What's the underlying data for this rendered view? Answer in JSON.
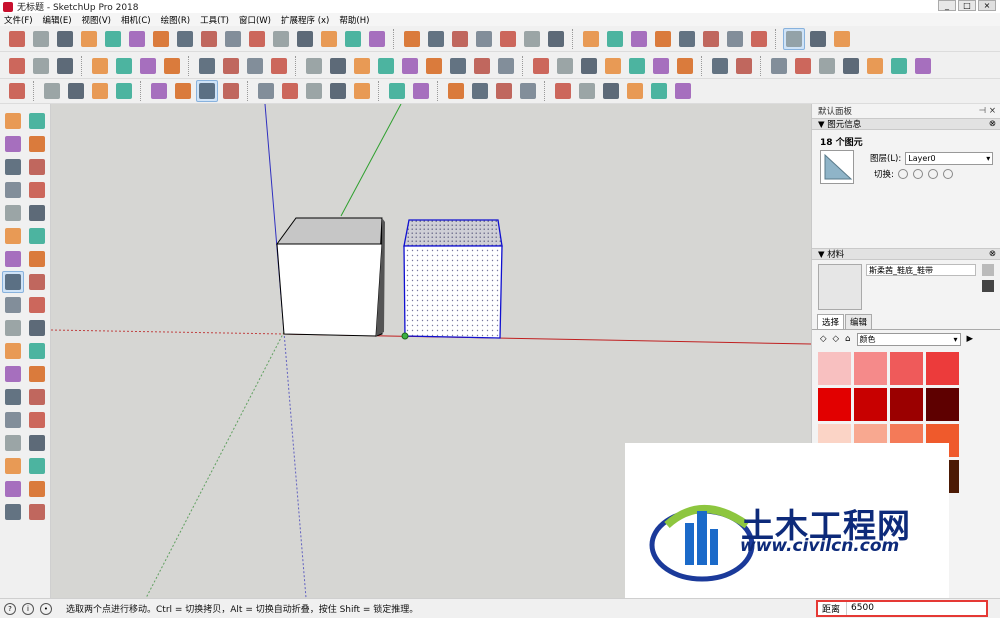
{
  "window": {
    "title": "无标题 - SketchUp Pro 2018",
    "controls": [
      "_",
      "□",
      "×"
    ]
  },
  "menu": [
    "文件(F)",
    "编辑(E)",
    "视图(V)",
    "相机(C)",
    "绘图(R)",
    "工具(T)",
    "窗口(W)",
    "扩展程序 (x)",
    "帮助(H)"
  ],
  "toolbar1_icons": [
    "select-icon",
    "make-component-icon",
    "paint-icon",
    "eraser-icon",
    "rectangle-icon",
    "line-icon",
    "circle-icon",
    "arc-icon",
    "polygon-icon",
    "freehand-icon",
    "move-icon",
    "pushpull-icon",
    "rotate-icon",
    "followme-icon",
    "scale-icon",
    "offset-icon",
    "tape-icon",
    "dimension-icon",
    "protractor-icon",
    "text-icon",
    "axes-icon",
    "3dtext-icon",
    "orbit-icon",
    "pan-icon",
    "zoom-icon",
    "zoom-extents-icon",
    "section-icon",
    "walk-icon",
    "lookaround-icon",
    "position-camera-icon",
    "sandbox-icon",
    "warehouse-icon",
    "extension-icon",
    "su-app-icon"
  ],
  "toolbar2_icons": [
    "new-icon",
    "open-icon",
    "save-icon",
    "cut-icon",
    "copy-icon",
    "paste-icon",
    "delete-icon",
    "undo-icon",
    "redo-icon",
    "print-icon",
    "model-info-icon",
    "camera-icon",
    "xray-icon",
    "back-edges-icon",
    "wireframe-icon",
    "hidden-line-icon",
    "shaded-icon",
    "textured-icon",
    "monochrome-icon",
    "shadow-icon",
    "fog-icon",
    "edge-style-icon",
    "styles-icon",
    "layers-icon",
    "scenes-icon",
    "sound-icon",
    "outliner-icon",
    "message-icon",
    "info-icon",
    "iso-view-icon",
    "top-view-icon",
    "front-view-icon",
    "right-view-icon",
    "back-view-icon",
    "left-view-icon",
    "bottom-view-icon"
  ],
  "toolbar3_icons": [
    "select-icon",
    "eraser-icon",
    "line-icon",
    "arc-icon",
    "shape-icon",
    "pushpull-icon",
    "followme-icon",
    "move-icon",
    "rotate-icon",
    "scale-icon",
    "tape-icon",
    "text-icon",
    "section-icon",
    "walk-icon",
    "zoom-icon",
    "zoom-extents-icon",
    "component-icon",
    "group-icon",
    "material-icon",
    "style-icon",
    "iso-icon",
    "front-icon",
    "home-icon",
    "house-icon",
    "house2-icon",
    "box-icon"
  ],
  "left_tools": [
    "select-icon",
    "make-component-icon",
    "paint-bucket-icon",
    "eraser-icon",
    "line-icon",
    "freehand-icon",
    "rectangle-icon",
    "rotated-rectangle-icon",
    "circle-icon",
    "polygon-icon",
    "arc-icon",
    "2point-arc-icon",
    "3point-arc-icon",
    "pie-icon",
    "move-icon",
    "pushpull-icon",
    "rotate-icon",
    "followme-icon",
    "scale-icon",
    "offset-icon",
    "tape-measure-icon",
    "dimension-icon",
    "protractor-icon",
    "text-icon",
    "axes-icon",
    "3d-text-icon",
    "orbit-icon",
    "pan-icon",
    "zoom-icon",
    "zoom-window-icon",
    "zoom-extents-icon",
    "previous-view-icon",
    "position-camera-icon",
    "look-around-icon",
    "walk-icon",
    "section-plane-icon"
  ],
  "status": {
    "text": "选取两个点进行移动。Ctrl = 切换拷贝，Alt = 切换自动折叠，按住 Shift = 锁定推理。",
    "measure_label": "距离",
    "measure_value": "6500"
  },
  "panel": {
    "title": "默认面板",
    "entity_section": "图元信息",
    "entity_count": "18 个图元",
    "layer_label": "图层(L):",
    "layer_value": "Layer0",
    "toggle_label": "切换:",
    "material_section": "材料",
    "material_name": "斯柔茜_鞋底_鞋带",
    "tab_select": "选择",
    "tab_edit": "编辑",
    "library": "颜色",
    "swatch_colors": [
      "#f8c0c0",
      "#f58a8a",
      "#ef5a5a",
      "#ec3b3b",
      "#e20000",
      "#c80000",
      "#9b0000",
      "#5e0000",
      "#fbd4c6",
      "#f8a890",
      "#f47a58",
      "#ef5a2c",
      "#c9501c",
      "#a83a10",
      "#7a2a08",
      "#4c1a04"
    ]
  },
  "watermark": {
    "line1": "土木工程网",
    "line2": "www.civilcn.com"
  }
}
